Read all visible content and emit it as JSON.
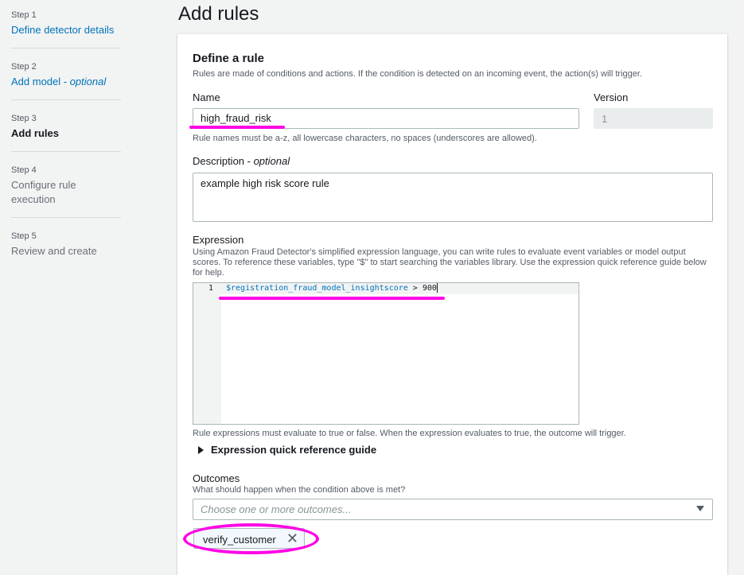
{
  "steps": [
    {
      "num": "Step 1",
      "title": "Define detector details",
      "state": "link"
    },
    {
      "num": "Step 2",
      "title": "Add model - ",
      "title_em": "optional",
      "state": "link"
    },
    {
      "num": "Step 3",
      "title": "Add rules",
      "state": "current"
    },
    {
      "num": "Step 4",
      "title_line1": "Configure rule",
      "title_line2": "execution",
      "state": "disabled"
    },
    {
      "num": "Step 5",
      "title": "Review and create",
      "state": "disabled"
    }
  ],
  "page_title": "Add rules",
  "rule": {
    "heading": "Define a rule",
    "description": "Rules are made of conditions and actions. If the condition is detected on an incoming event, the action(s) will trigger.",
    "name_label": "Name",
    "name_value": "high_fraud_risk",
    "name_hint": "Rule names must be a-z, all lowercase characters, no spaces (underscores are allowed).",
    "version_label": "Version",
    "version_value": "1",
    "description_label": "Description - ",
    "description_label_em": "optional",
    "description_value": "example high risk score rule",
    "expression_label": "Expression",
    "expression_help_1": "Using Amazon Fraud Detector's simplified expression language, you can write rules to evaluate event variables or model output",
    "expression_help_2": "scores. To reference these variables, type \"$\" to start searching the variables library. Use the expression quick reference guide below",
    "expression_help_3": "for help.",
    "expression_line_number": "1",
    "expression_variable": "$registration_fraud_model_insightscore",
    "expression_operator": " > ",
    "expression_number": "900",
    "expression_hint": "Rule expressions must evaluate to true or false. When the expression evaluates to true, the outcome will trigger.",
    "reference_guide": "Expression quick reference guide",
    "outcomes_label": "Outcomes",
    "outcomes_hint": "What should happen when the condition above is met?",
    "outcomes_placeholder": "Choose one or more outcomes...",
    "selected_outcome": "verify_customer",
    "remove_glyph": "✕"
  },
  "colors": {
    "link": "#0073bb",
    "annotation": "#ff00e6",
    "background": "#f2f3f3"
  },
  "icons": [
    "caret-right-icon",
    "chevron-down-icon",
    "close-icon"
  ]
}
